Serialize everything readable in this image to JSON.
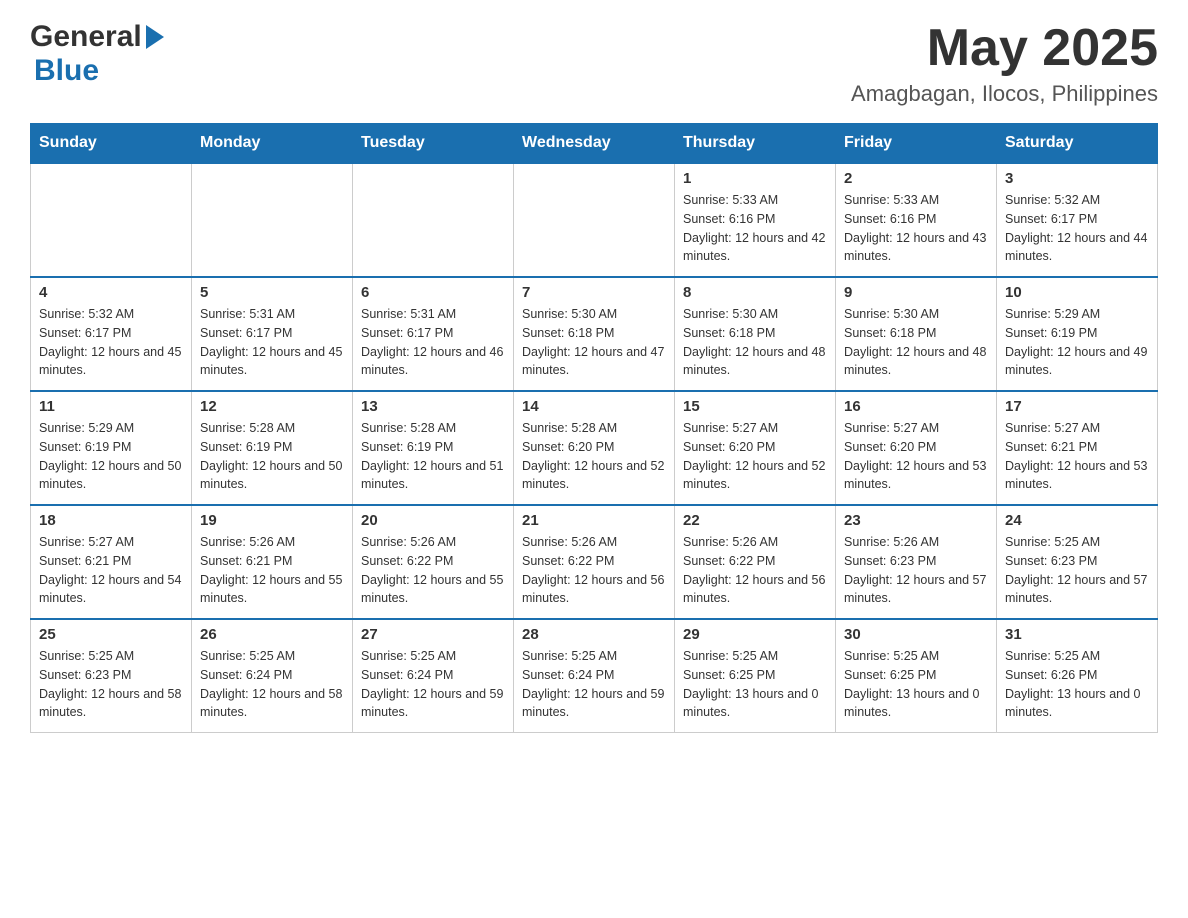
{
  "header": {
    "logo_general": "General",
    "logo_blue": "Blue",
    "month_title": "May 2025",
    "location": "Amagbagan, Ilocos, Philippines"
  },
  "weekdays": [
    "Sunday",
    "Monday",
    "Tuesday",
    "Wednesday",
    "Thursday",
    "Friday",
    "Saturday"
  ],
  "weeks": [
    {
      "days": [
        {
          "number": "",
          "sunrise": "",
          "sunset": "",
          "daylight": ""
        },
        {
          "number": "",
          "sunrise": "",
          "sunset": "",
          "daylight": ""
        },
        {
          "number": "",
          "sunrise": "",
          "sunset": "",
          "daylight": ""
        },
        {
          "number": "",
          "sunrise": "",
          "sunset": "",
          "daylight": ""
        },
        {
          "number": "1",
          "sunrise": "Sunrise: 5:33 AM",
          "sunset": "Sunset: 6:16 PM",
          "daylight": "Daylight: 12 hours and 42 minutes."
        },
        {
          "number": "2",
          "sunrise": "Sunrise: 5:33 AM",
          "sunset": "Sunset: 6:16 PM",
          "daylight": "Daylight: 12 hours and 43 minutes."
        },
        {
          "number": "3",
          "sunrise": "Sunrise: 5:32 AM",
          "sunset": "Sunset: 6:17 PM",
          "daylight": "Daylight: 12 hours and 44 minutes."
        }
      ]
    },
    {
      "days": [
        {
          "number": "4",
          "sunrise": "Sunrise: 5:32 AM",
          "sunset": "Sunset: 6:17 PM",
          "daylight": "Daylight: 12 hours and 45 minutes."
        },
        {
          "number": "5",
          "sunrise": "Sunrise: 5:31 AM",
          "sunset": "Sunset: 6:17 PM",
          "daylight": "Daylight: 12 hours and 45 minutes."
        },
        {
          "number": "6",
          "sunrise": "Sunrise: 5:31 AM",
          "sunset": "Sunset: 6:17 PM",
          "daylight": "Daylight: 12 hours and 46 minutes."
        },
        {
          "number": "7",
          "sunrise": "Sunrise: 5:30 AM",
          "sunset": "Sunset: 6:18 PM",
          "daylight": "Daylight: 12 hours and 47 minutes."
        },
        {
          "number": "8",
          "sunrise": "Sunrise: 5:30 AM",
          "sunset": "Sunset: 6:18 PM",
          "daylight": "Daylight: 12 hours and 48 minutes."
        },
        {
          "number": "9",
          "sunrise": "Sunrise: 5:30 AM",
          "sunset": "Sunset: 6:18 PM",
          "daylight": "Daylight: 12 hours and 48 minutes."
        },
        {
          "number": "10",
          "sunrise": "Sunrise: 5:29 AM",
          "sunset": "Sunset: 6:19 PM",
          "daylight": "Daylight: 12 hours and 49 minutes."
        }
      ]
    },
    {
      "days": [
        {
          "number": "11",
          "sunrise": "Sunrise: 5:29 AM",
          "sunset": "Sunset: 6:19 PM",
          "daylight": "Daylight: 12 hours and 50 minutes."
        },
        {
          "number": "12",
          "sunrise": "Sunrise: 5:28 AM",
          "sunset": "Sunset: 6:19 PM",
          "daylight": "Daylight: 12 hours and 50 minutes."
        },
        {
          "number": "13",
          "sunrise": "Sunrise: 5:28 AM",
          "sunset": "Sunset: 6:19 PM",
          "daylight": "Daylight: 12 hours and 51 minutes."
        },
        {
          "number": "14",
          "sunrise": "Sunrise: 5:28 AM",
          "sunset": "Sunset: 6:20 PM",
          "daylight": "Daylight: 12 hours and 52 minutes."
        },
        {
          "number": "15",
          "sunrise": "Sunrise: 5:27 AM",
          "sunset": "Sunset: 6:20 PM",
          "daylight": "Daylight: 12 hours and 52 minutes."
        },
        {
          "number": "16",
          "sunrise": "Sunrise: 5:27 AM",
          "sunset": "Sunset: 6:20 PM",
          "daylight": "Daylight: 12 hours and 53 minutes."
        },
        {
          "number": "17",
          "sunrise": "Sunrise: 5:27 AM",
          "sunset": "Sunset: 6:21 PM",
          "daylight": "Daylight: 12 hours and 53 minutes."
        }
      ]
    },
    {
      "days": [
        {
          "number": "18",
          "sunrise": "Sunrise: 5:27 AM",
          "sunset": "Sunset: 6:21 PM",
          "daylight": "Daylight: 12 hours and 54 minutes."
        },
        {
          "number": "19",
          "sunrise": "Sunrise: 5:26 AM",
          "sunset": "Sunset: 6:21 PM",
          "daylight": "Daylight: 12 hours and 55 minutes."
        },
        {
          "number": "20",
          "sunrise": "Sunrise: 5:26 AM",
          "sunset": "Sunset: 6:22 PM",
          "daylight": "Daylight: 12 hours and 55 minutes."
        },
        {
          "number": "21",
          "sunrise": "Sunrise: 5:26 AM",
          "sunset": "Sunset: 6:22 PM",
          "daylight": "Daylight: 12 hours and 56 minutes."
        },
        {
          "number": "22",
          "sunrise": "Sunrise: 5:26 AM",
          "sunset": "Sunset: 6:22 PM",
          "daylight": "Daylight: 12 hours and 56 minutes."
        },
        {
          "number": "23",
          "sunrise": "Sunrise: 5:26 AM",
          "sunset": "Sunset: 6:23 PM",
          "daylight": "Daylight: 12 hours and 57 minutes."
        },
        {
          "number": "24",
          "sunrise": "Sunrise: 5:25 AM",
          "sunset": "Sunset: 6:23 PM",
          "daylight": "Daylight: 12 hours and 57 minutes."
        }
      ]
    },
    {
      "days": [
        {
          "number": "25",
          "sunrise": "Sunrise: 5:25 AM",
          "sunset": "Sunset: 6:23 PM",
          "daylight": "Daylight: 12 hours and 58 minutes."
        },
        {
          "number": "26",
          "sunrise": "Sunrise: 5:25 AM",
          "sunset": "Sunset: 6:24 PM",
          "daylight": "Daylight: 12 hours and 58 minutes."
        },
        {
          "number": "27",
          "sunrise": "Sunrise: 5:25 AM",
          "sunset": "Sunset: 6:24 PM",
          "daylight": "Daylight: 12 hours and 59 minutes."
        },
        {
          "number": "28",
          "sunrise": "Sunrise: 5:25 AM",
          "sunset": "Sunset: 6:24 PM",
          "daylight": "Daylight: 12 hours and 59 minutes."
        },
        {
          "number": "29",
          "sunrise": "Sunrise: 5:25 AM",
          "sunset": "Sunset: 6:25 PM",
          "daylight": "Daylight: 13 hours and 0 minutes."
        },
        {
          "number": "30",
          "sunrise": "Sunrise: 5:25 AM",
          "sunset": "Sunset: 6:25 PM",
          "daylight": "Daylight: 13 hours and 0 minutes."
        },
        {
          "number": "31",
          "sunrise": "Sunrise: 5:25 AM",
          "sunset": "Sunset: 6:26 PM",
          "daylight": "Daylight: 13 hours and 0 minutes."
        }
      ]
    }
  ]
}
